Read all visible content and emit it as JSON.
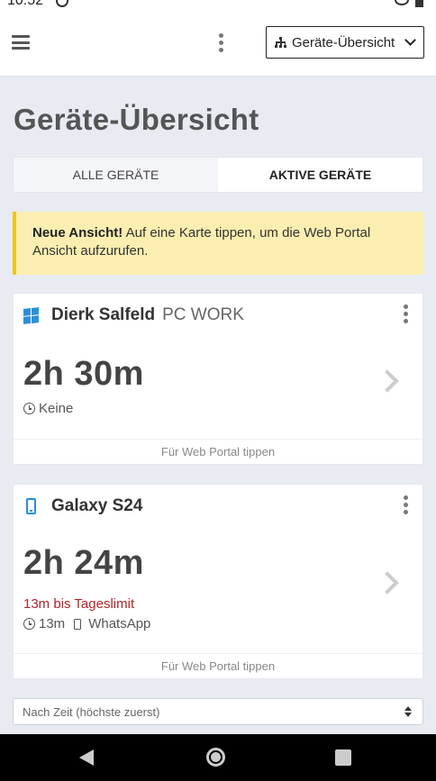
{
  "status_bar": {
    "time": "10:52"
  },
  "header": {
    "view_select_label": "Geräte-Übersicht"
  },
  "page_title": "Geräte-Übersicht",
  "tabs": [
    {
      "label": "ALLE GERÄTE",
      "active": false
    },
    {
      "label": "AKTIVE GERÄTE",
      "active": true
    }
  ],
  "notice": {
    "bold": "Neue Ansicht!",
    "text": " Auf eine Karte tippen, um die Web Portal Ansicht aufzurufen."
  },
  "devices": [
    {
      "icon": "windows-icon",
      "name": "Dierk Salfeld",
      "device": "PC WORK",
      "duration": "2h 30m",
      "limit_text": "",
      "clock_value": "Keine",
      "app_name": "",
      "footer": "Für Web Portal tippen"
    },
    {
      "icon": "smartphone-icon",
      "name": "Galaxy S24",
      "device": "",
      "duration": "2h 24m",
      "limit_text": "13m bis Tageslimit",
      "clock_value": "13m",
      "app_name": "WhatsApp",
      "footer": "Für Web Portal tippen"
    }
  ],
  "sort": {
    "label": "Nach Zeit (höchste zuerst)"
  },
  "colors": {
    "accent_blue": "#2b8fd8",
    "limit_red": "#b0242a",
    "notice_bg": "#fbeeb0",
    "notice_border": "#f0c419"
  }
}
